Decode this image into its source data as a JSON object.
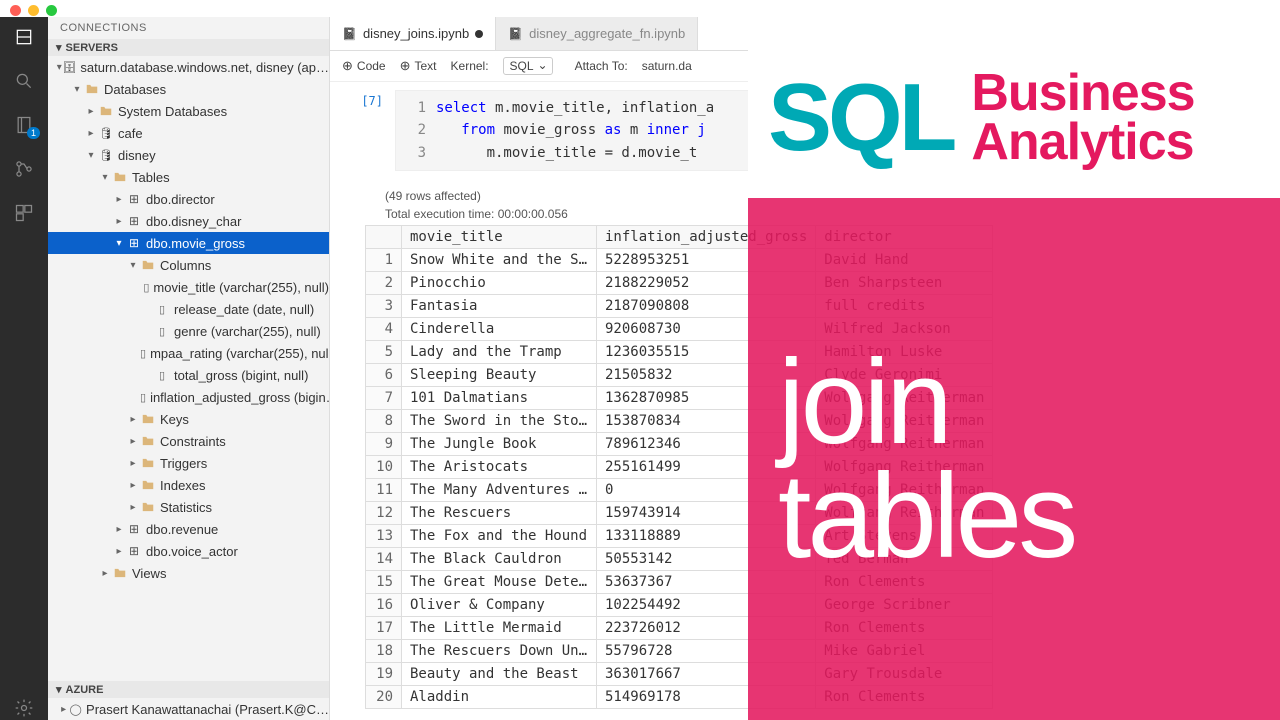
{
  "sidebar": {
    "title": "CONNECTIONS",
    "sections": {
      "servers": "SERVERS",
      "azure": "AZURE"
    },
    "server_label": "saturn.database.windows.net, disney (ap…",
    "databases_label": "Databases",
    "sysdb_label": "System Databases",
    "db_cafe": "cafe",
    "db_disney": "disney",
    "tables_label": "Tables",
    "tables": [
      "dbo.director",
      "dbo.disney_char",
      "dbo.movie_gross",
      "dbo.revenue",
      "dbo.voice_actor"
    ],
    "columns_label": "Columns",
    "columns": [
      "movie_title (varchar(255), null)",
      "release_date (date, null)",
      "genre (varchar(255), null)",
      "mpaa_rating (varchar(255), null)",
      "total_gross (bigint, null)",
      "inflation_adjusted_gross (bigin…"
    ],
    "folders_after": [
      "Keys",
      "Constraints",
      "Triggers",
      "Indexes",
      "Statistics"
    ],
    "views_label": "Views",
    "azure_user": "Prasert Kanawattanachai (Prasert.K@C…"
  },
  "tabs": [
    {
      "label": "disney_joins.ipynb",
      "active": true,
      "dirty": true
    },
    {
      "label": "disney_aggregate_fn.ipynb",
      "active": false,
      "dirty": false
    }
  ],
  "toolbar": {
    "code": "Code",
    "text": "Text",
    "kernel_label": "Kernel:",
    "kernel_value": "SQL",
    "attach_label": "Attach To:",
    "attach_value": "saturn.da"
  },
  "cell": {
    "prompt": "[7]",
    "lines": [
      {
        "n": "1",
        "pre": "",
        "tokens": [
          [
            "kw",
            "select"
          ],
          [
            "",
            " m.movie_title, inflation_a"
          ]
        ]
      },
      {
        "n": "2",
        "pre": "   ",
        "tokens": [
          [
            "kw",
            "from"
          ],
          [
            "",
            " movie_gross "
          ],
          [
            "kw",
            "as"
          ],
          [
            "",
            " m "
          ],
          [
            "kw",
            "inner j"
          ]
        ]
      },
      {
        "n": "3",
        "pre": "      ",
        "tokens": [
          [
            "",
            "m.movie_title = d.movie_t"
          ]
        ]
      }
    ]
  },
  "output": {
    "rows_affected": "(49 rows affected)",
    "exec_time": "Total execution time: 00:00:00.056",
    "headers": [
      "movie_title",
      "inflation_adjusted_gross",
      "director"
    ],
    "rows": [
      [
        "Snow White and the Sev…",
        "5228953251",
        "David Hand"
      ],
      [
        "Pinocchio",
        "2188229052",
        "Ben Sharpsteen"
      ],
      [
        "Fantasia",
        "2187090808",
        "full credits"
      ],
      [
        "Cinderella",
        "920608730",
        "Wilfred Jackson"
      ],
      [
        "Lady and the Tramp",
        "1236035515",
        "Hamilton Luske"
      ],
      [
        "Sleeping Beauty",
        "21505832",
        "Clyde Geronimi"
      ],
      [
        "101 Dalmatians",
        "1362870985",
        "Wolfgang Reitherman"
      ],
      [
        "The Sword in the Stone",
        "153870834",
        "Wolfgang Reitherman"
      ],
      [
        "The Jungle Book",
        "789612346",
        "Wolfgang Reitherman"
      ],
      [
        "The Aristocats",
        "255161499",
        "Wolfgang Reitherman"
      ],
      [
        "The Many Adventures of…",
        "0",
        "Wolfgang Reitherman"
      ],
      [
        "The Rescuers",
        "159743914",
        "Wolfgang Reitherman"
      ],
      [
        "The Fox and the Hound",
        "133118889",
        "Art Stevens"
      ],
      [
        "The Black Cauldron",
        "50553142",
        "Ted Berman"
      ],
      [
        "The Great Mouse Detect…",
        "53637367",
        "Ron Clements"
      ],
      [
        "Oliver & Company",
        "102254492",
        "George Scribner"
      ],
      [
        "The Little Mermaid",
        "223726012",
        "Ron Clements"
      ],
      [
        "The Rescuers Down Under",
        "55796728",
        "Mike Gabriel"
      ],
      [
        "Beauty and the Beast",
        "363017667",
        "Gary Trousdale"
      ],
      [
        "Aladdin",
        "514969178",
        "Ron Clements"
      ]
    ]
  },
  "overlay": {
    "sql": "SQL",
    "biz": "Business",
    "ana": "Analytics",
    "l1": "join",
    "l2": "tables"
  }
}
